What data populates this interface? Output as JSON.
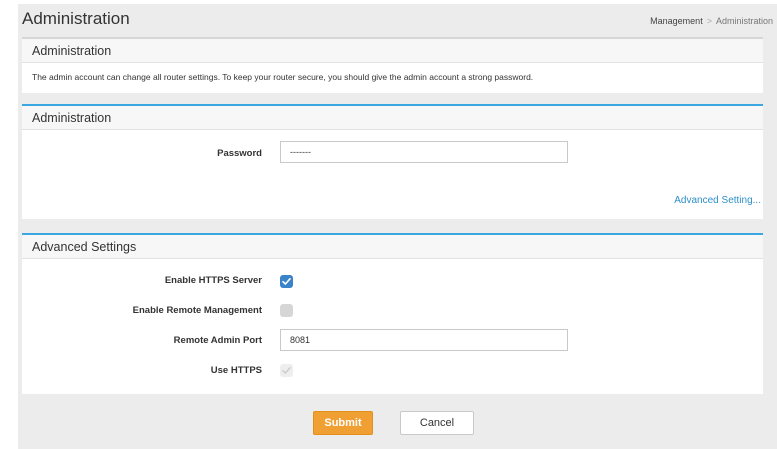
{
  "header": {
    "title": "Administration",
    "breadcrumb": {
      "parent": "Management",
      "separator": ">",
      "current": "Administration"
    }
  },
  "info_panel": {
    "title": "Administration",
    "description": "The admin account can change all router settings. To keep your router secure, you should give the admin account a strong password."
  },
  "admin_panel": {
    "title": "Administration",
    "password_label": "Password",
    "password_value": "-------",
    "advanced_link": "Advanced Setting..."
  },
  "advanced_panel": {
    "title": "Advanced Settings",
    "https_server_label": "Enable HTTPS Server",
    "https_server_checked": true,
    "remote_mgmt_label": "Enable Remote Management",
    "remote_mgmt_checked": false,
    "remote_port_label": "Remote Admin Port",
    "remote_port_value": "8081",
    "use_https_label": "Use HTTPS",
    "use_https_checked": true,
    "use_https_disabled": true
  },
  "actions": {
    "submit_label": "Submit",
    "cancel_label": "Cancel"
  },
  "colors": {
    "accent_blue": "#3ba7e0",
    "checkbox_blue": "#3b83c8",
    "submit_orange": "#f0a033",
    "link_blue": "#2e8fc9"
  }
}
